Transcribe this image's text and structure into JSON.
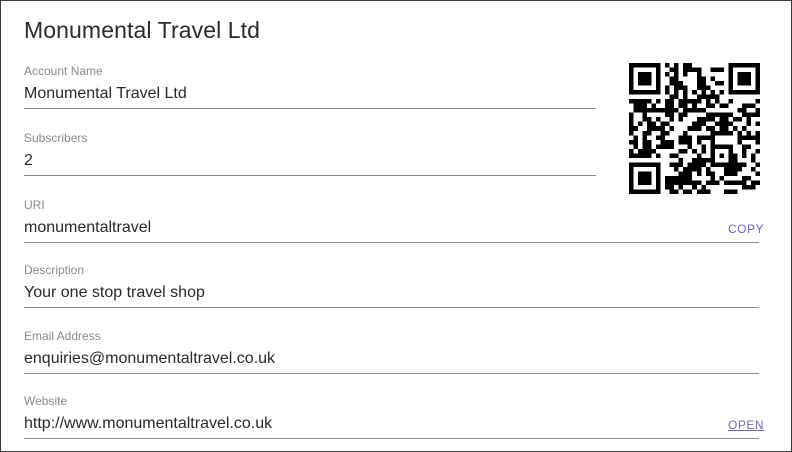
{
  "title": "Monumental Travel Ltd",
  "fields": {
    "account_name": {
      "label": "Account Name",
      "value": "Monumental Travel Ltd"
    },
    "subscribers": {
      "label": "Subscribers",
      "value": "2"
    },
    "uri": {
      "label": "URI",
      "value": "monumentaltravel",
      "action": "COPY"
    },
    "description": {
      "label": "Description",
      "value": "Your one stop travel shop"
    },
    "email": {
      "label": "Email Address",
      "value": "enquiries@monumentaltravel.co.uk"
    },
    "website": {
      "label": "Website",
      "value": "http://www.monumentaltravel.co.uk",
      "action": "OPEN"
    }
  },
  "qr_code": {
    "icon": "qr-code-icon"
  },
  "colors": {
    "action_link": "#6e6bb0",
    "underline": "#8c8c8c"
  }
}
